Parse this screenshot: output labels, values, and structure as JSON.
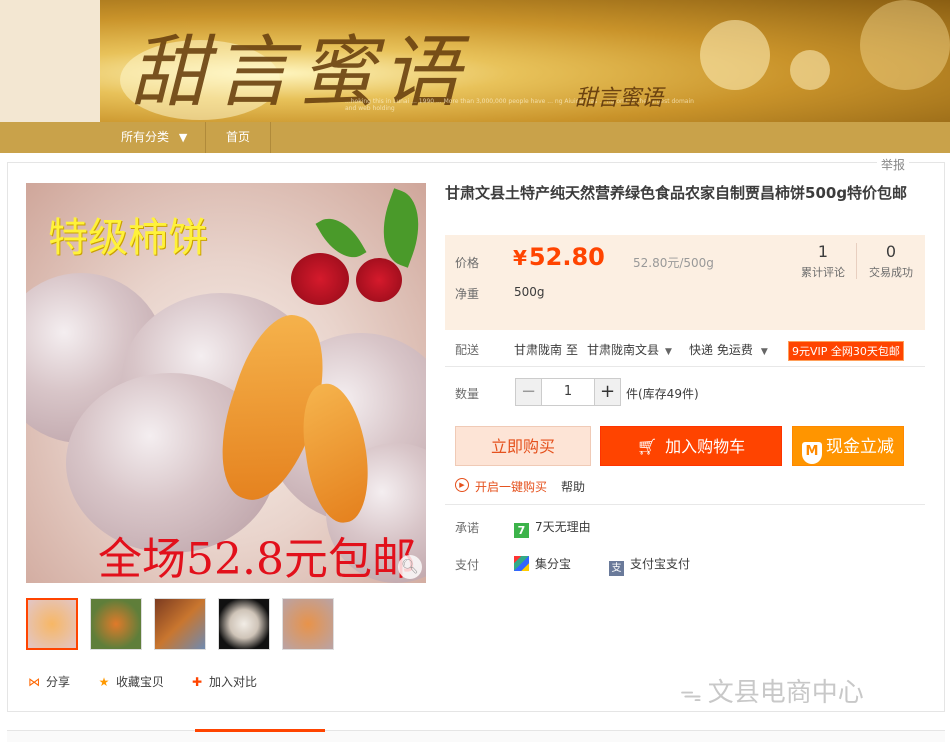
{
  "banner": {
    "title": "甜言蜜语",
    "subtitle": "甜言蜜语",
    "fine_print": "...hoking this in Lunai ... 1990 ... More than 3,000,000 people have ... ng Aiuidai has ... ng one of the largest domain and web holding"
  },
  "nav": {
    "all_categories": "所有分类",
    "dropdown_arrow": "▼",
    "home": "首页"
  },
  "report": "举报",
  "product": {
    "title": "甘肃文县土特产纯天然营养绿色食品农家自制贾昌柿饼500g特价包邮",
    "image_text_top": "特级柿饼",
    "image_text_bottom": "全场52.8元包邮"
  },
  "price": {
    "label": "价格",
    "currency": "¥",
    "value": "52.80",
    "unit_price": "52.80元/500g",
    "weight_label": "净重",
    "weight_value": "500g"
  },
  "stats": {
    "reviews_count": "1",
    "reviews_label": "累计评论",
    "deals_count": "0",
    "deals_label": "交易成功"
  },
  "delivery": {
    "label": "配送",
    "from": "甘肃陇南",
    "to_word": "至",
    "to": "甘肃陇南文县",
    "shipping": "快递 免运费",
    "vip": "9元VIP 全网30天包邮"
  },
  "quantity": {
    "label": "数量",
    "minus": "−",
    "value": "1",
    "plus": "+",
    "stock": "件(库存49件)"
  },
  "buttons": {
    "buy_now": "立即购买",
    "add_to_cart": "加入购物车",
    "cash_discount": "现金立减"
  },
  "oneclick": {
    "text": "开启一键购买",
    "help": "帮助"
  },
  "promise": {
    "label": "承诺",
    "item": "7天无理由",
    "icon_text": "7"
  },
  "payment": {
    "label": "支付",
    "method1": "集分宝",
    "method2": "支付宝支付"
  },
  "actions": {
    "share": "分享",
    "favorite": "收藏宝贝",
    "compare": "加入对比"
  },
  "watermark": "文县电商中心",
  "colors": {
    "accent": "#ff4400",
    "nav": "#c9a24a",
    "price_bg": "#fcefe2"
  }
}
